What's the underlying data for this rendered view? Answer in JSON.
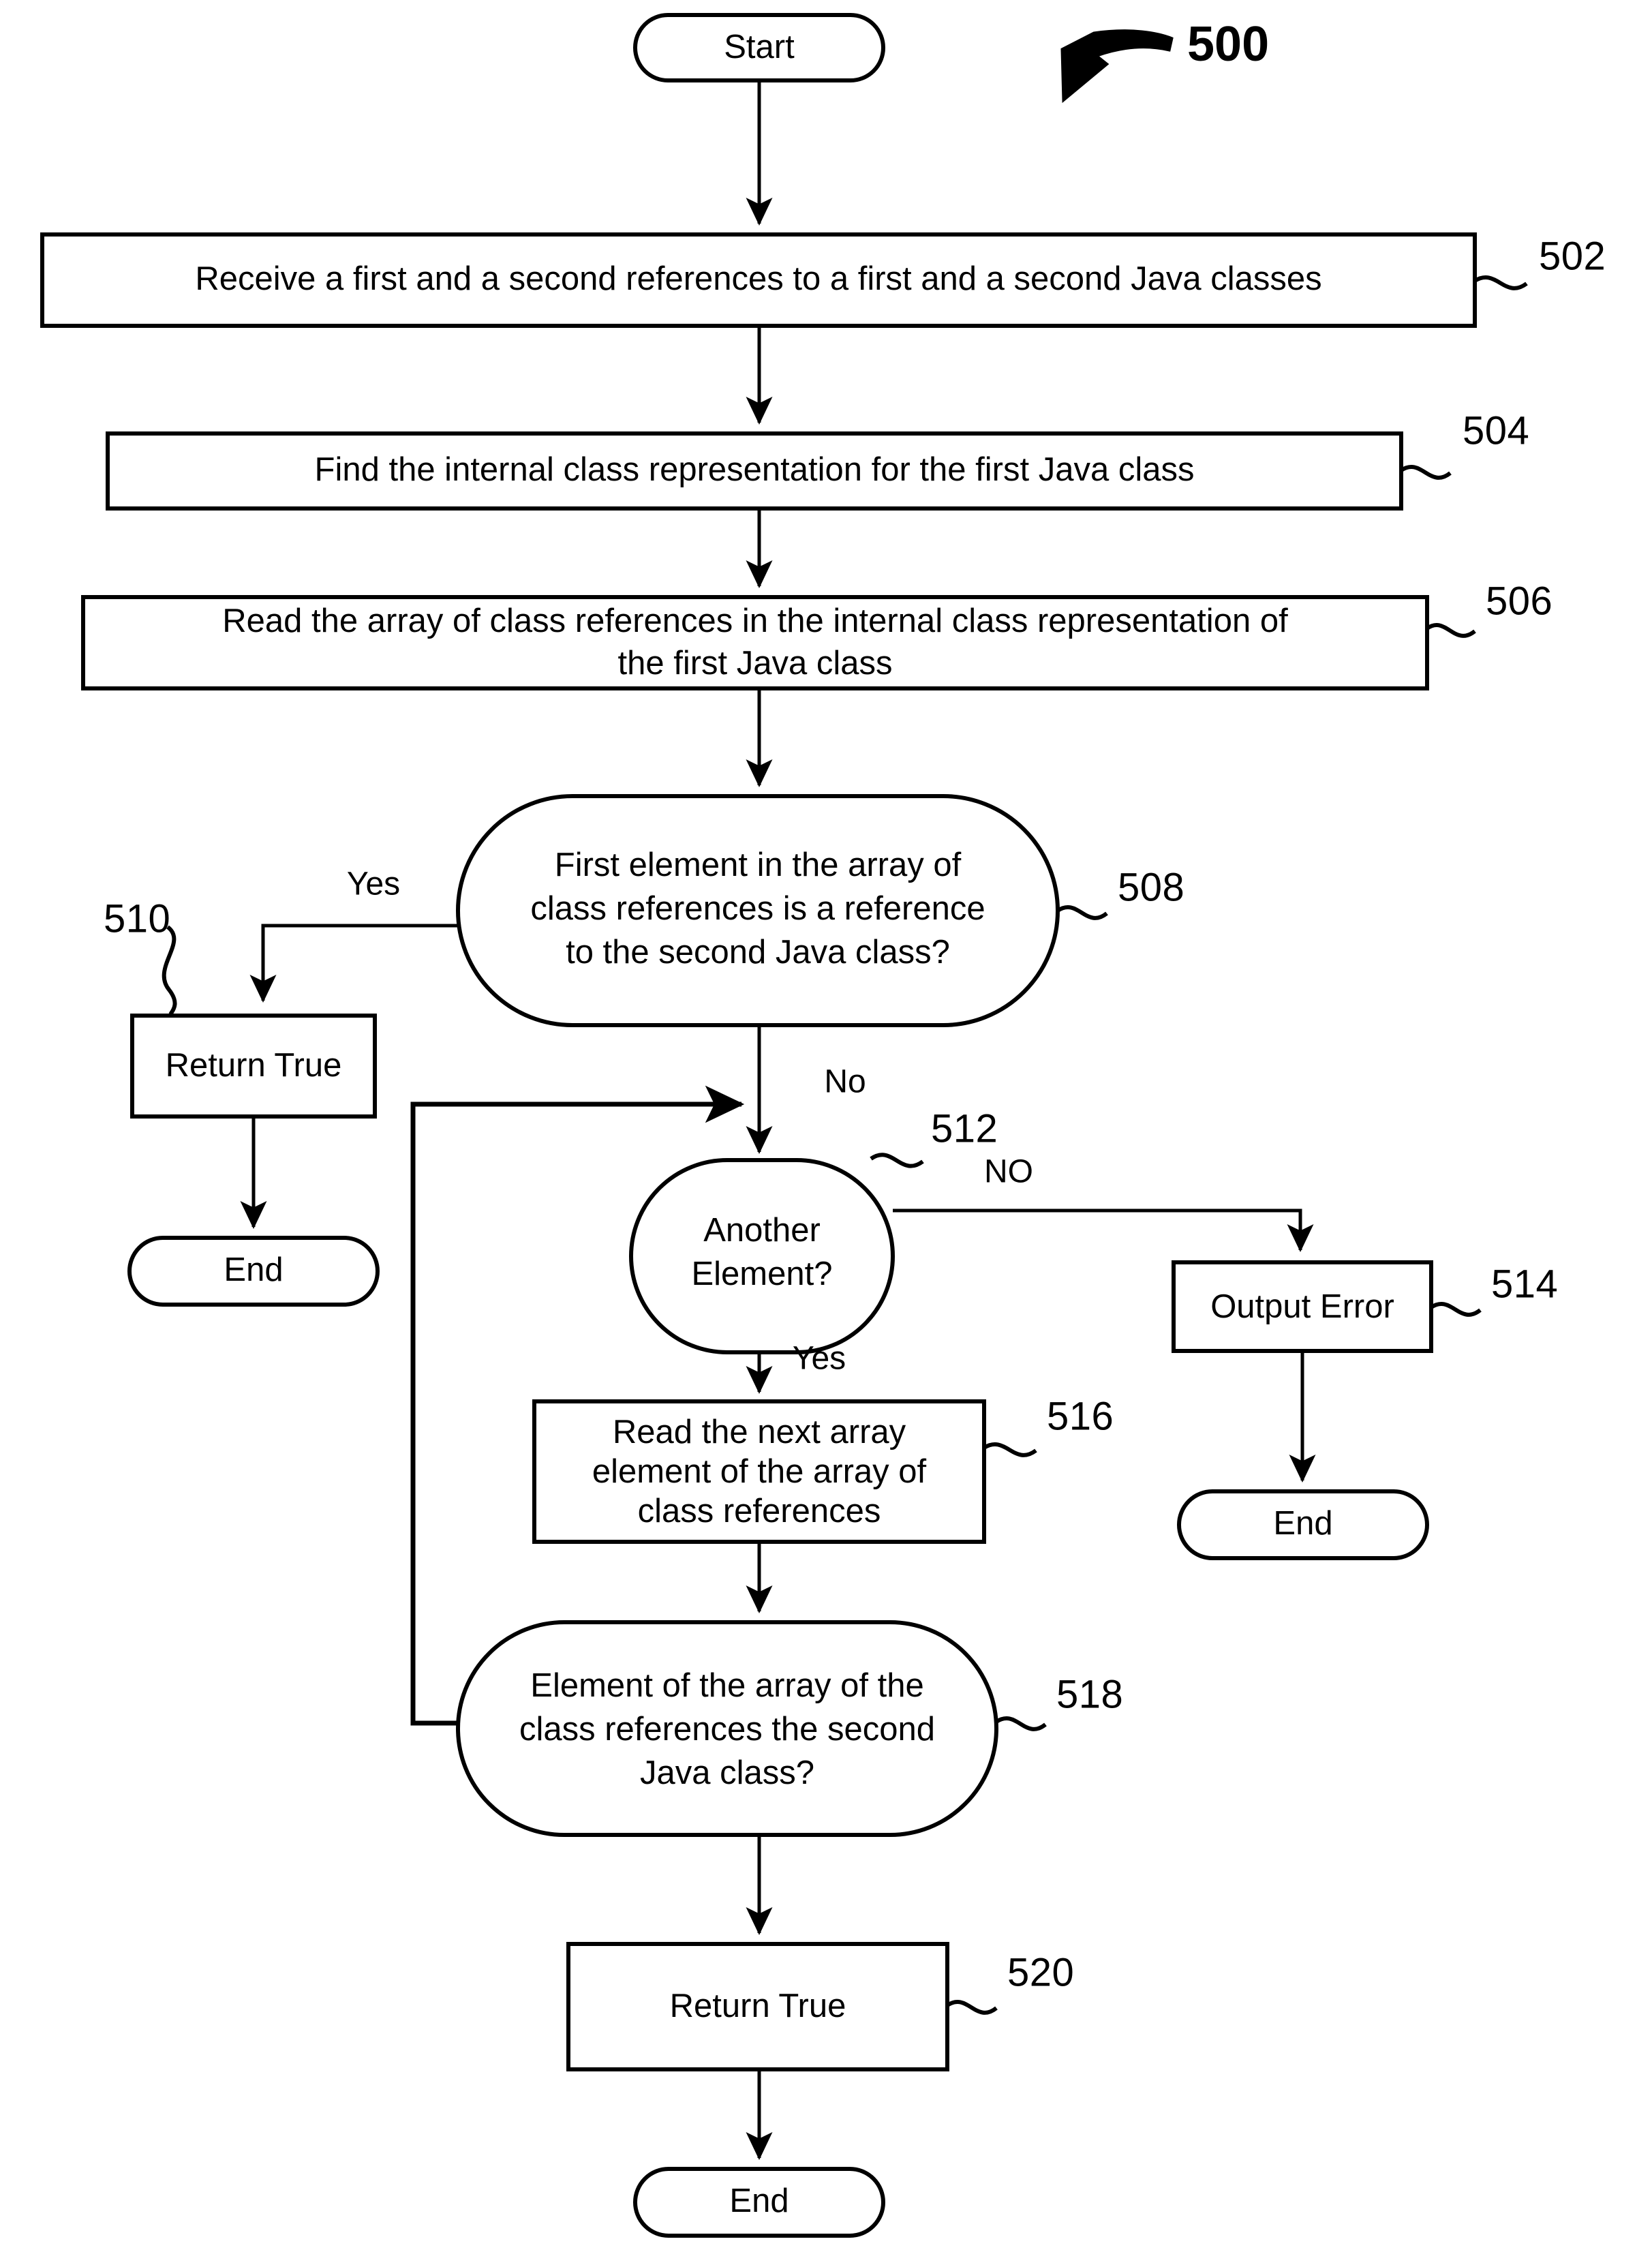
{
  "figure": {
    "number": "500",
    "pointer_icon": "curved-arrow-icon"
  },
  "nodes": {
    "start": {
      "label": "Start",
      "shape": "terminator"
    },
    "step502": {
      "label": "Receive a first and a second references to a first and a second Java classes",
      "ref": "502",
      "shape": "process"
    },
    "step504": {
      "label": "Find the internal class representation for the first Java class",
      "ref": "504",
      "shape": "process"
    },
    "step506": {
      "line1": "Read the array of class references in the internal class representation of",
      "line2": "the first Java class",
      "ref": "506",
      "shape": "process"
    },
    "decision508": {
      "line1": "First element in the array of",
      "line2": "class references is a reference",
      "line3": "to the second Java class?",
      "ref": "508",
      "shape": "decision"
    },
    "step510": {
      "label": "Return True",
      "ref": "510",
      "shape": "process"
    },
    "end1": {
      "label": "End",
      "shape": "terminator"
    },
    "decision512": {
      "line1": "Another",
      "line2": "Element?",
      "ref": "512",
      "shape": "decision"
    },
    "step514": {
      "label": "Output Error",
      "ref": "514",
      "shape": "process"
    },
    "end2": {
      "label": "End",
      "shape": "terminator"
    },
    "step516": {
      "line1": "Read the next array",
      "line2": "element of the array of",
      "line3": "class references",
      "ref": "516",
      "shape": "process"
    },
    "decision518": {
      "line1": "Element of the array of the",
      "line2": "class references the second",
      "line3": "Java class?",
      "ref": "518",
      "shape": "decision"
    },
    "step520": {
      "label": "Return True",
      "ref": "520",
      "shape": "process"
    },
    "end3": {
      "label": "End",
      "shape": "terminator"
    }
  },
  "edge_labels": {
    "yes508": "Yes",
    "no508": "No",
    "no512": "NO",
    "yes512": "Yes"
  },
  "colors": {
    "stroke": "#000000",
    "fill": "#ffffff",
    "background": "#ffffff"
  }
}
